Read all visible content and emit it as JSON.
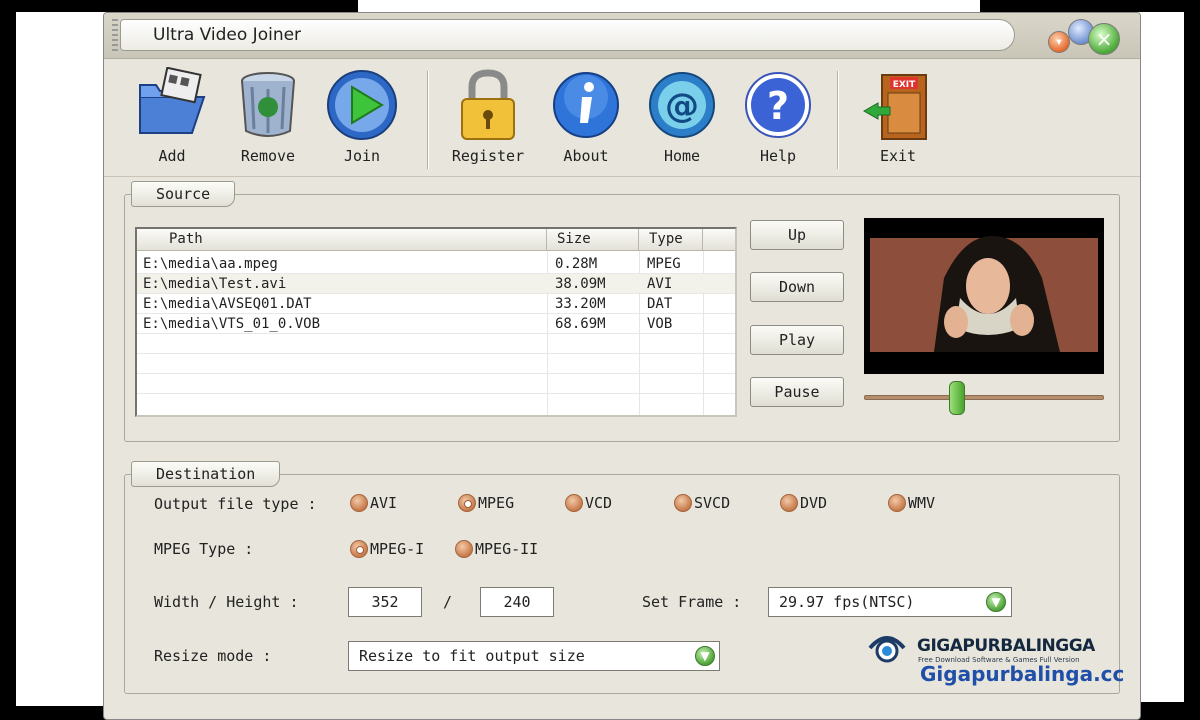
{
  "window": {
    "title": "Ultra Video Joiner"
  },
  "toolbar": {
    "add": "Add",
    "remove": "Remove",
    "join": "Join",
    "register": "Register",
    "about": "About",
    "home": "Home",
    "help": "Help",
    "exit": "Exit",
    "exit_sign": "EXIT"
  },
  "source": {
    "legend": "Source",
    "columns": [
      "Path",
      "Size",
      "Type"
    ],
    "rows": [
      {
        "path": "E:\\media\\aa.mpeg",
        "size": "0.28M",
        "type": "MPEG"
      },
      {
        "path": "E:\\media\\Test.avi",
        "size": "38.09M",
        "type": "AVI"
      },
      {
        "path": "E:\\media\\AVSEQ01.DAT",
        "size": "33.20M",
        "type": "DAT"
      },
      {
        "path": "E:\\media\\VTS_01_0.VOB",
        "size": "68.69M",
        "type": "VOB"
      }
    ],
    "buttons": {
      "up": "Up",
      "down": "Down",
      "play": "Play",
      "pause": "Pause"
    }
  },
  "destination": {
    "legend": "Destination",
    "output_type_label": "Output file type :",
    "output_types": [
      "AVI",
      "MPEG",
      "VCD",
      "SVCD",
      "DVD",
      "WMV"
    ],
    "output_selected": "MPEG",
    "mpeg_type_label": "MPEG Type :",
    "mpeg_types": [
      "MPEG-I",
      "MPEG-II"
    ],
    "mpeg_selected": "MPEG-I",
    "size_label": "Width / Height :",
    "width": "352",
    "separator": "/",
    "height": "240",
    "frame_label": "Set Frame :",
    "frame_value": "29.97 fps(NTSC)",
    "resize_label": "Resize mode :",
    "resize_value": "Resize to fit output size"
  },
  "watermark": {
    "brand": "GIGAPURBALINGGA",
    "tagline": "Free Download Software & Games Full Version",
    "url": "Gigapurbalinga.cc"
  }
}
